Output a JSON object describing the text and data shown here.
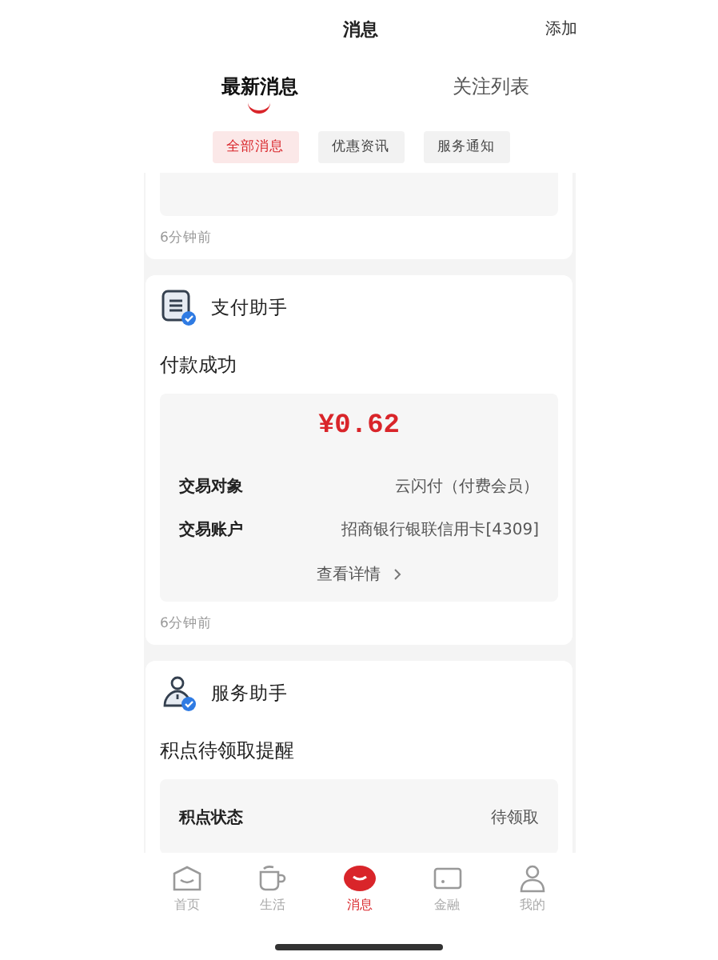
{
  "header": {
    "title": "消息",
    "action": "添加"
  },
  "tabs": [
    {
      "label": "最新消息",
      "selected": true
    },
    {
      "label": "关注列表",
      "selected": false
    }
  ],
  "filters": [
    {
      "label": "全部消息",
      "selected": true
    },
    {
      "label": "优惠资讯",
      "selected": false
    },
    {
      "label": "服务通知",
      "selected": false
    }
  ],
  "messages": [
    {
      "kind": "partial",
      "time": "6分钟前"
    },
    {
      "kind": "payment",
      "sender": "支付助手",
      "title": "付款成功",
      "amount": "¥0.62",
      "fields": [
        {
          "label": "交易对象",
          "value": "云闪付（付费会员）"
        },
        {
          "label": "交易账户",
          "value": "招商银行银联信用卡[4309]"
        }
      ],
      "link": "查看详情",
      "time": "6分钟前"
    },
    {
      "kind": "service",
      "sender": "服务助手",
      "title": "积点待领取提醒",
      "fields": [
        {
          "label": "积点状态",
          "value": "待领取"
        }
      ]
    }
  ],
  "nav": [
    {
      "label": "首页",
      "selected": false
    },
    {
      "label": "生活",
      "selected": false
    },
    {
      "label": "消息",
      "selected": true
    },
    {
      "label": "金融",
      "selected": false
    },
    {
      "label": "我的",
      "selected": false
    }
  ]
}
